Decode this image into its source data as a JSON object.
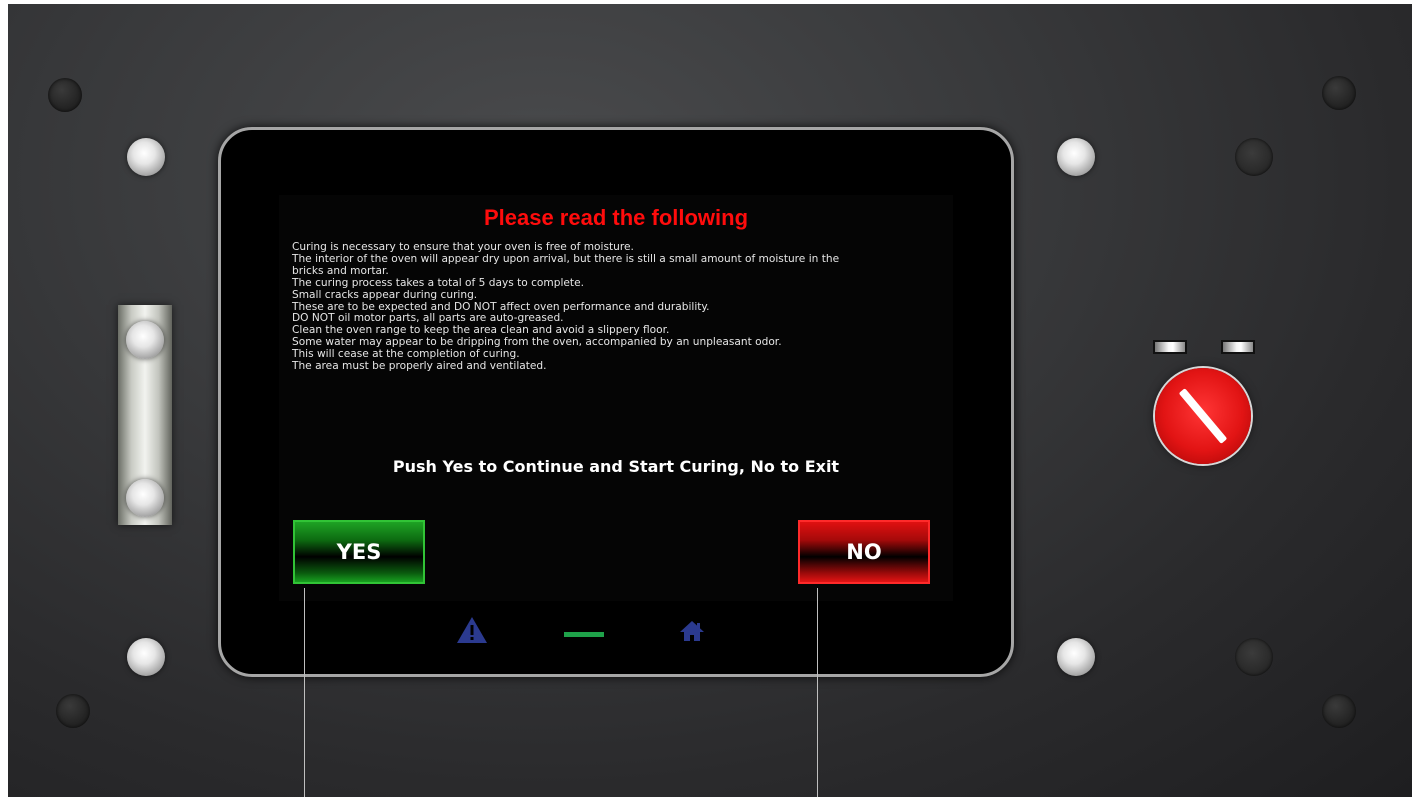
{
  "dialog": {
    "title": "Please read the following",
    "notes": [
      "Curing is necessary to ensure that your oven is free of moisture.",
      "The interior of the oven will appear dry upon arrival, but there is still a small amount of moisture in the",
      "bricks and mortar.",
      "The curing process takes a total of 5 days to complete.",
      "Small cracks appear during curing.",
      "These are to be expected and DO NOT affect oven performance and durability.",
      "DO NOT oil motor parts, all parts are auto-greased.",
      "Clean the oven range to keep the area clean and avoid a slippery floor.",
      "Some water may appear to be dripping from the oven, accompanied by an unpleasant odor.",
      "This will cease at the completion of curing.",
      "The area must be properly aired and ventilated."
    ],
    "prompt": "Push Yes to Continue and Start Curing, No to Exit",
    "yes_label": "YES",
    "no_label": "NO"
  },
  "nav": {
    "icons": [
      "warning-icon",
      "minimize-icon",
      "home-icon"
    ]
  },
  "colors": {
    "title": "#ff0c0c",
    "yes": "#1ea324",
    "no": "#e01010",
    "nav_icon": "#2b3a8f",
    "dash": "#1fa24a",
    "estop": "#e21414"
  }
}
